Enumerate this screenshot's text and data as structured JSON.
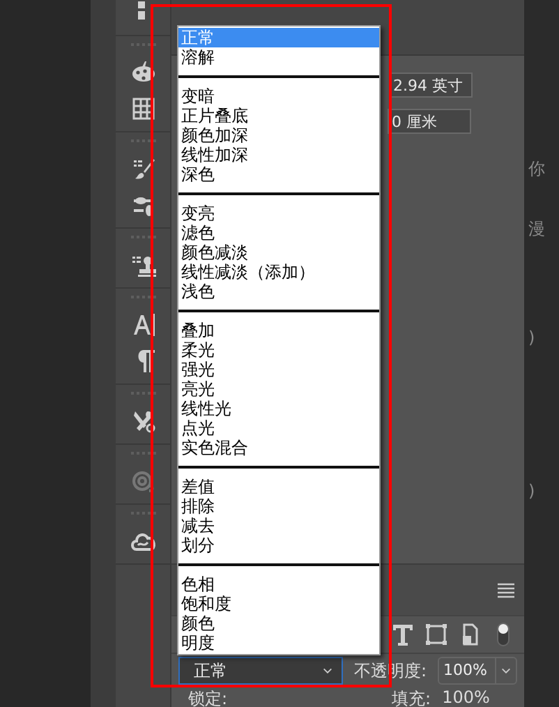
{
  "properties": {
    "size_value": "2.94 英寸",
    "offset_value": "0 厘米"
  },
  "side_texts": [
    "你",
    "漫",
    ")",
    ")"
  ],
  "blend_menu": {
    "groups": [
      {
        "items": [
          {
            "label": "正常",
            "selected": true
          },
          {
            "label": "溶解",
            "selected": false
          }
        ]
      },
      {
        "items": [
          {
            "label": "变暗",
            "selected": false
          },
          {
            "label": "正片叠底",
            "selected": false
          },
          {
            "label": "颜色加深",
            "selected": false
          },
          {
            "label": "线性加深",
            "selected": false
          },
          {
            "label": "深色",
            "selected": false
          }
        ]
      },
      {
        "items": [
          {
            "label": "变亮",
            "selected": false
          },
          {
            "label": "滤色",
            "selected": false
          },
          {
            "label": "颜色减淡",
            "selected": false
          },
          {
            "label": "线性减淡（添加）",
            "selected": false
          },
          {
            "label": "浅色",
            "selected": false
          }
        ]
      },
      {
        "items": [
          {
            "label": "叠加",
            "selected": false
          },
          {
            "label": "柔光",
            "selected": false
          },
          {
            "label": "强光",
            "selected": false
          },
          {
            "label": "亮光",
            "selected": false
          },
          {
            "label": "线性光",
            "selected": false
          },
          {
            "label": "点光",
            "selected": false
          },
          {
            "label": "实色混合",
            "selected": false
          }
        ]
      },
      {
        "items": [
          {
            "label": "差值",
            "selected": false
          },
          {
            "label": "排除",
            "selected": false
          },
          {
            "label": "减去",
            "selected": false
          },
          {
            "label": "划分",
            "selected": false
          }
        ]
      },
      {
        "items": [
          {
            "label": "色相",
            "selected": false
          },
          {
            "label": "饱和度",
            "selected": false
          },
          {
            "label": "颜色",
            "selected": false
          },
          {
            "label": "明度",
            "selected": false
          }
        ]
      }
    ]
  },
  "layers_panel": {
    "blend_mode": "正常",
    "opacity_label": "不透明度:",
    "opacity": "100%",
    "lock_label": "锁定:",
    "fill_label": "填充:",
    "fill": "100%"
  }
}
